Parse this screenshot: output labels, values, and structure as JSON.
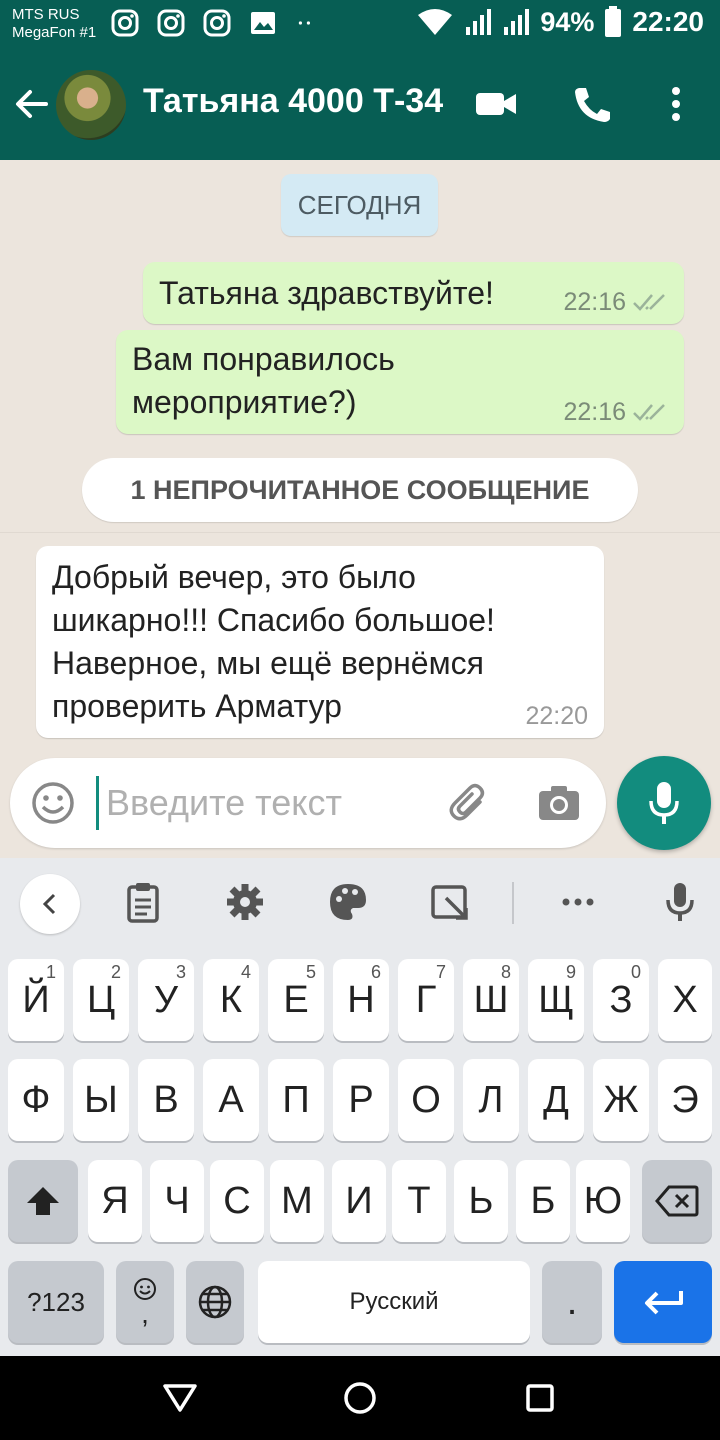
{
  "status_bar": {
    "carrier_line1": "MTS RUS",
    "carrier_line2": "MegaFon #1",
    "battery": "94%",
    "time": "22:20",
    "icons": [
      "instagram-icon",
      "instagram-icon",
      "instagram-icon",
      "image-icon",
      "dots-icon",
      "wifi-icon",
      "signal-icon",
      "signal-icon",
      "battery-icon"
    ]
  },
  "header": {
    "title": "Татьяна 4000 Т-34",
    "icons": [
      "back-arrow-icon",
      "video-call-icon",
      "phone-icon",
      "more-vert-icon"
    ]
  },
  "chat": {
    "date_chip": "СЕГОДНЯ",
    "messages": [
      {
        "direction": "out",
        "text": "Татьяна здравствуйте!",
        "time": "22:16",
        "status": "read"
      },
      {
        "direction": "out",
        "line1": "Вам понравилось",
        "line2": "мероприятие?)",
        "time": "22:16",
        "status": "read"
      },
      {
        "direction": "in",
        "line1": "Добрый вечер, это было",
        "line2": "шикарно!!! Спасибо большое!",
        "line3": "Наверное, мы ещё вернёмся",
        "line4": "проверить Арматур",
        "time": "22:20"
      }
    ],
    "unread_label": "1 НЕПРОЧИТАННОЕ СООБЩЕНИЕ"
  },
  "composer": {
    "placeholder": "Введите текст",
    "icons": [
      "emoji-icon",
      "attach-icon",
      "camera-icon",
      "mic-icon"
    ]
  },
  "keyboard": {
    "row1": [
      "Й",
      "Ц",
      "У",
      "К",
      "Е",
      "Н",
      "Г",
      "Ш",
      "Щ",
      "З",
      "Х"
    ],
    "row1_hints": [
      "1",
      "2",
      "3",
      "4",
      "5",
      "6",
      "7",
      "8",
      "9",
      "0",
      ""
    ],
    "row2": [
      "Ф",
      "Ы",
      "В",
      "А",
      "П",
      "Р",
      "О",
      "Л",
      "Д",
      "Ж",
      "Э"
    ],
    "row3": [
      "Я",
      "Ч",
      "С",
      "М",
      "И",
      "Т",
      "Ь",
      "Б",
      "Ю"
    ],
    "key_123": "?123",
    "key_comma": ",",
    "space_label": "Русский",
    "key_period": ".",
    "toolbar_icons": [
      "chevron-left-icon",
      "clipboard-icon",
      "settings-icon",
      "palette-icon",
      "resize-icon",
      "more-horiz-icon",
      "mic-icon"
    ]
  },
  "colors": {
    "header": "#075e54",
    "outgoing_bubble": "#dcf8c6",
    "incoming_bubble": "#ffffff",
    "fab": "#128c7e",
    "enter_key": "#1a73e8",
    "chat_bg": "#ece5dd"
  }
}
